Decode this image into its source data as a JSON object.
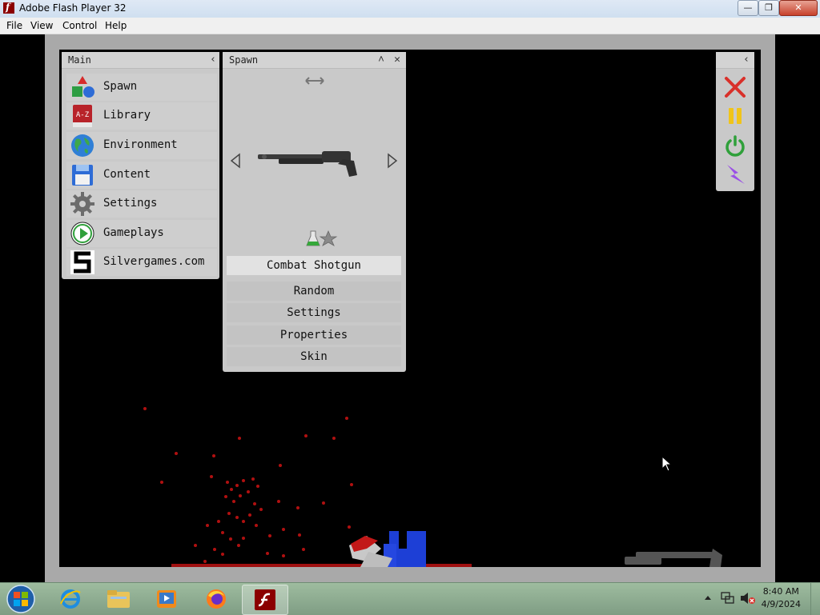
{
  "window": {
    "title": "Adobe Flash Player 32"
  },
  "menu": [
    "File",
    "View",
    "Control",
    "Help"
  ],
  "main_panel": {
    "title": "Main",
    "items": [
      {
        "label": "Spawn",
        "icon": "shapes-icon"
      },
      {
        "label": "Library",
        "icon": "book-icon"
      },
      {
        "label": "Environment",
        "icon": "globe-icon"
      },
      {
        "label": "Content",
        "icon": "floppy-disk-icon"
      },
      {
        "label": "Settings",
        "icon": "gear-icon"
      },
      {
        "label": "Gameplays",
        "icon": "play-icon"
      },
      {
        "label": "Silvergames.com",
        "icon": "silvergames-logo-icon"
      }
    ]
  },
  "spawn_panel": {
    "title": "Spawn",
    "selected_item": "Combat Shotgun",
    "buttons": [
      "Random",
      "Settings",
      "Properties",
      "Skin"
    ]
  },
  "tools_panel": {
    "tools": [
      {
        "icon": "close-x-icon",
        "color": "#d9302a"
      },
      {
        "icon": "pause-icon",
        "color": "#f0c419"
      },
      {
        "icon": "power-icon",
        "color": "#2fa03a"
      },
      {
        "icon": "lightning-icon",
        "color": "#9a4fe6"
      }
    ]
  },
  "taskbar": {
    "time": "8:40 AM",
    "date": "4/9/2024"
  }
}
